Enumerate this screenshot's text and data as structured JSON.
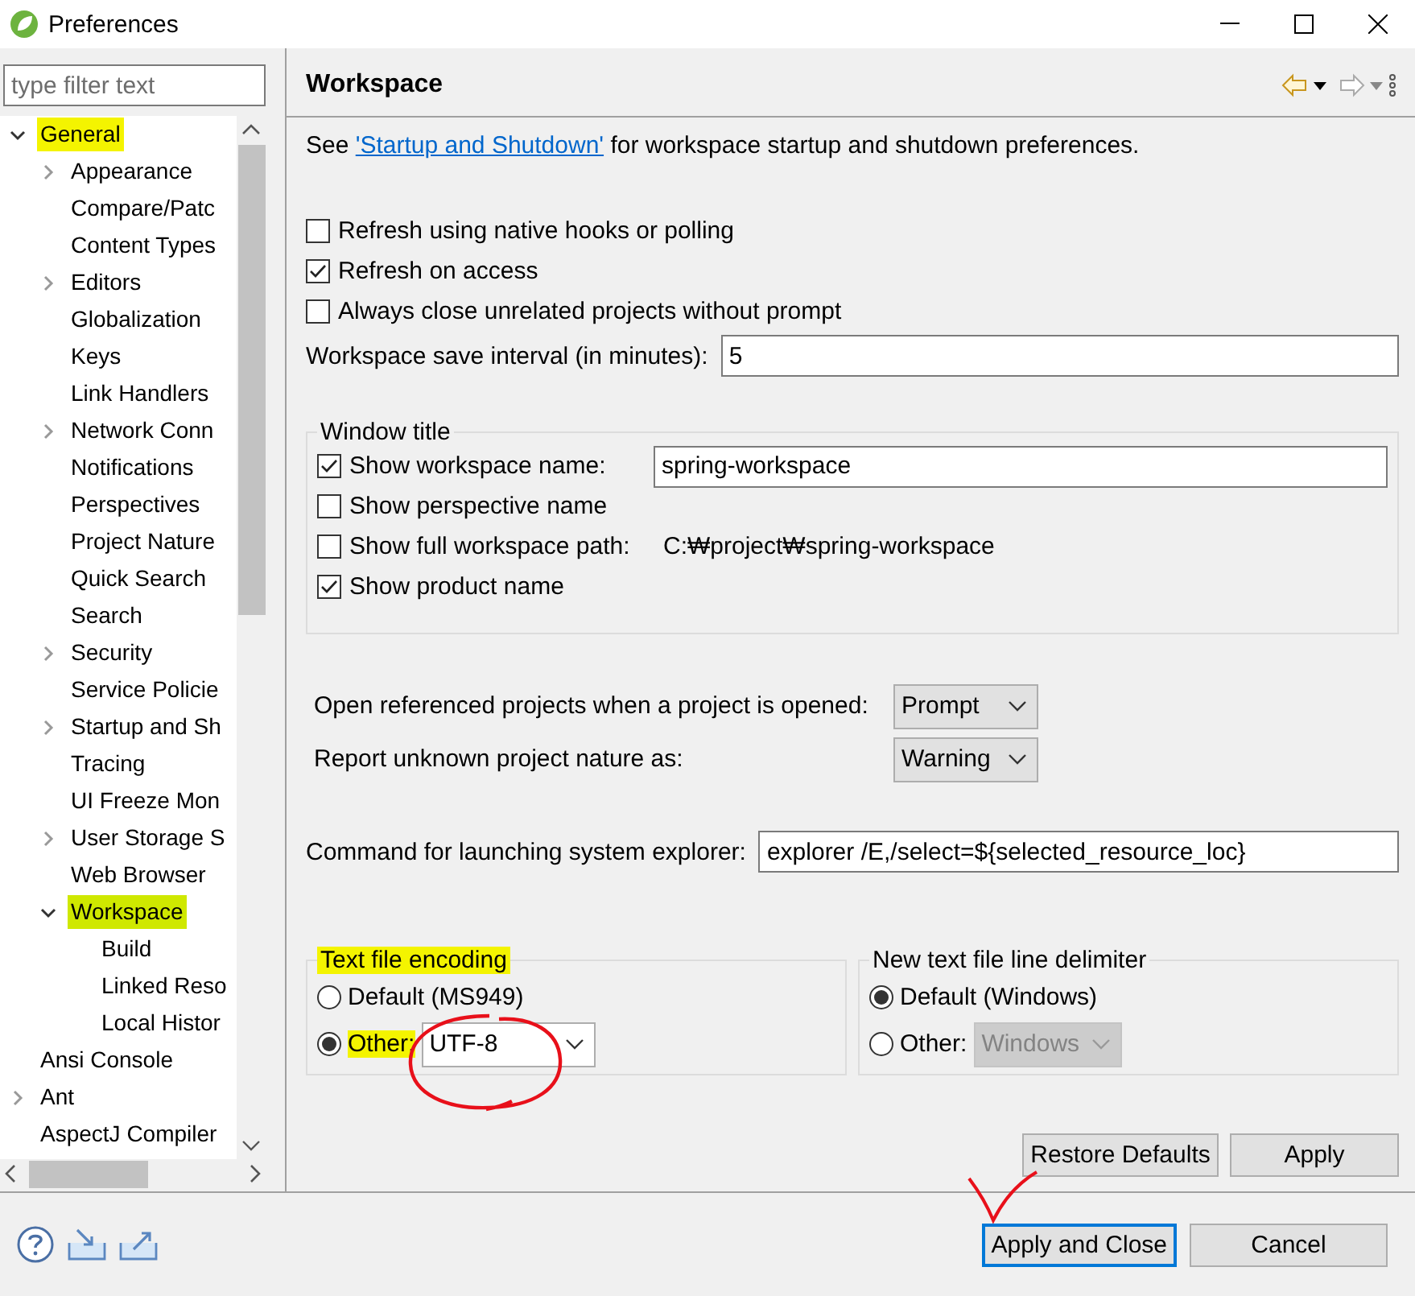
{
  "window": {
    "title": "Preferences"
  },
  "filter": {
    "placeholder": "type filter text"
  },
  "tree": [
    {
      "label": "General",
      "kind": "branch",
      "expanded": true,
      "selected": false,
      "highlighted": true,
      "children": [
        {
          "label": "Appearance",
          "kind": "branch",
          "expanded": false,
          "selected": false,
          "highlighted": false
        },
        {
          "label": "Compare/Patc",
          "kind": "leaf",
          "selected": false,
          "highlighted": false
        },
        {
          "label": "Content Types",
          "kind": "leaf",
          "selected": false,
          "highlighted": false
        },
        {
          "label": "Editors",
          "kind": "branch",
          "expanded": false,
          "selected": false,
          "highlighted": false
        },
        {
          "label": "Globalization",
          "kind": "leaf",
          "selected": false,
          "highlighted": false
        },
        {
          "label": "Keys",
          "kind": "leaf",
          "selected": false,
          "highlighted": false
        },
        {
          "label": "Link Handlers",
          "kind": "leaf",
          "selected": false,
          "highlighted": false
        },
        {
          "label": "Network Conn",
          "kind": "branch",
          "expanded": false,
          "selected": false,
          "highlighted": false
        },
        {
          "label": "Notifications",
          "kind": "leaf",
          "selected": false,
          "highlighted": false
        },
        {
          "label": "Perspectives",
          "kind": "leaf",
          "selected": false,
          "highlighted": false
        },
        {
          "label": "Project Nature",
          "kind": "leaf",
          "selected": false,
          "highlighted": false
        },
        {
          "label": "Quick Search",
          "kind": "leaf",
          "selected": false,
          "highlighted": false
        },
        {
          "label": "Search",
          "kind": "leaf",
          "selected": false,
          "highlighted": false
        },
        {
          "label": "Security",
          "kind": "branch",
          "expanded": false,
          "selected": false,
          "highlighted": false
        },
        {
          "label": "Service Policie",
          "kind": "leaf",
          "selected": false,
          "highlighted": false
        },
        {
          "label": "Startup and Sh",
          "kind": "branch",
          "expanded": false,
          "selected": false,
          "highlighted": false
        },
        {
          "label": "Tracing",
          "kind": "leaf",
          "selected": false,
          "highlighted": false
        },
        {
          "label": "UI Freeze Mon",
          "kind": "leaf",
          "selected": false,
          "highlighted": false
        },
        {
          "label": "User Storage S",
          "kind": "branch",
          "expanded": false,
          "selected": false,
          "highlighted": false
        },
        {
          "label": "Web Browser",
          "kind": "leaf",
          "selected": false,
          "highlighted": false
        },
        {
          "label": "Workspace",
          "kind": "branch",
          "expanded": true,
          "selected": true,
          "highlighted": true,
          "children": [
            {
              "label": "Build",
              "kind": "leaf",
              "selected": false,
              "highlighted": false
            },
            {
              "label": "Linked Reso",
              "kind": "leaf",
              "selected": false,
              "highlighted": false
            },
            {
              "label": "Local Histor",
              "kind": "leaf",
              "selected": false,
              "highlighted": false
            }
          ]
        }
      ]
    },
    {
      "label": "Ansi Console",
      "kind": "leaf",
      "selected": false,
      "highlighted": false
    },
    {
      "label": "Ant",
      "kind": "branch",
      "expanded": false,
      "selected": false,
      "highlighted": false
    },
    {
      "label": "AspectJ Compiler",
      "kind": "leaf",
      "selected": false,
      "highlighted": false
    }
  ],
  "page": {
    "title": "Workspace",
    "intro_before": "See ",
    "intro_link": "'Startup and Shutdown'",
    "intro_after": " for workspace startup and shutdown preferences."
  },
  "options": [
    {
      "label": "Refresh using native hooks or polling",
      "checked": false
    },
    {
      "label": "Refresh on access",
      "checked": true
    },
    {
      "label": "Always close unrelated projects without prompt",
      "checked": false
    }
  ],
  "save_interval": {
    "label": "Workspace save interval (in minutes):",
    "value": "5"
  },
  "window_title_group": {
    "title": "Window title",
    "rows": [
      {
        "kind": "field",
        "label": "Show workspace name:",
        "checked": true,
        "value": "spring-workspace"
      },
      {
        "kind": "plain",
        "label": "Show perspective name",
        "checked": false
      },
      {
        "kind": "path",
        "label": "Show full workspace path:",
        "checked": false,
        "value": "C:₩project₩spring-workspace"
      },
      {
        "kind": "plain",
        "label": "Show product name",
        "checked": true
      }
    ]
  },
  "selects": [
    {
      "label": "Open referenced projects when a project is opened:",
      "value": "Prompt"
    },
    {
      "label": "Report unknown project nature as:",
      "value": "Warning"
    }
  ],
  "explorer_command": {
    "label": "Command for launching system explorer:",
    "value": "explorer /E,/select=${selected_resource_loc}"
  },
  "encoding": {
    "title": "Text file encoding",
    "highlighted": true,
    "options": [
      {
        "label": "Default (MS949)",
        "selected": false,
        "highlighted": false
      },
      {
        "label": "Other:",
        "selected": true,
        "highlighted": true,
        "value": "UTF-8"
      }
    ]
  },
  "delimiter": {
    "title": "New text file line delimiter",
    "highlighted": false,
    "options": [
      {
        "label": "Default (Windows)",
        "selected": true,
        "highlighted": false
      },
      {
        "label": "Other:",
        "selected": false,
        "highlighted": false,
        "value": "Windows"
      }
    ]
  },
  "page_buttons": [
    "Restore Defaults",
    "Apply"
  ],
  "dialog_buttons": [
    {
      "label": "Apply and Close",
      "default": true
    },
    {
      "label": "Cancel",
      "default": false
    }
  ],
  "annotations": [
    {
      "kind": "circle"
    },
    {
      "kind": "check"
    }
  ]
}
